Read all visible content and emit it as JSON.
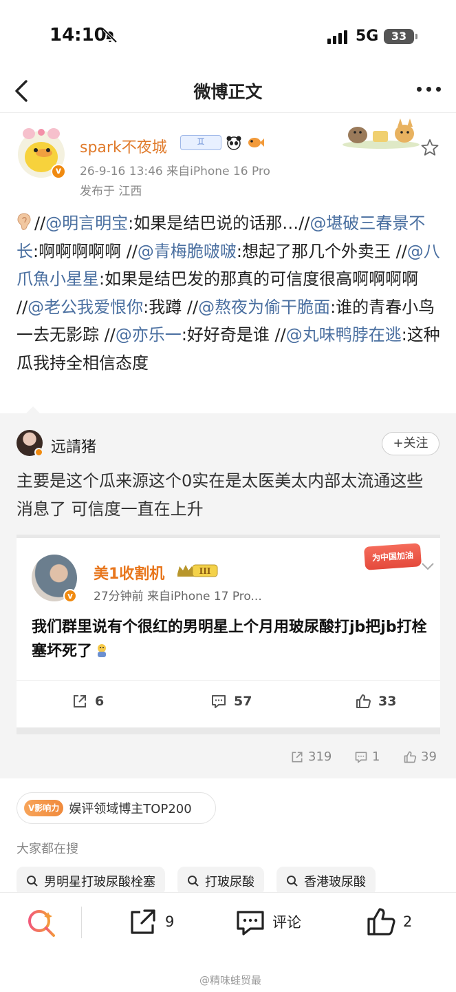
{
  "status_bar": {
    "time": "14:10",
    "network": "5G",
    "battery": "33"
  },
  "nav": {
    "title": "微博正文"
  },
  "post": {
    "username": "spark不夜城",
    "level_badge": "♊",
    "meta": "26-9-16 13:46  来自iPhone 16 Pro",
    "location": "发布于 江西",
    "segments": [
      {
        "t": "//",
        "m": false
      },
      {
        "t": "@明言明宝",
        "m": true
      },
      {
        "t": ":如果是结巴说的话那…//",
        "m": false
      },
      {
        "t": "@堪破三春景不长",
        "m": true
      },
      {
        "t": ":啊啊啊啊啊 //",
        "m": false
      },
      {
        "t": "@青梅脆啵啵",
        "m": true
      },
      {
        "t": ":想起了那几个外卖王 //",
        "m": false
      },
      {
        "t": "@八爪魚小星星",
        "m": true
      },
      {
        "t": ":如果是结巴发的那真的可信度很高啊啊啊啊 //",
        "m": false
      },
      {
        "t": "@老公我爱恨你",
        "m": true
      },
      {
        "t": ":我蹲 //",
        "m": false
      },
      {
        "t": "@熬夜为偷干脆面",
        "m": true
      },
      {
        "t": ":谁的青春小鸟一去无影踪 //",
        "m": false
      },
      {
        "t": "@亦乐一",
        "m": true
      },
      {
        "t": ":好好奇是谁 //",
        "m": false
      },
      {
        "t": "@丸味鸭脖在逃",
        "m": true
      },
      {
        "t": ":这种瓜我持全相信态度",
        "m": false
      }
    ]
  },
  "repost": {
    "username": "远請猪",
    "follow_label": "+关注",
    "text": "主要是这个瓜来源这个0实在是太医美太内部太流通这些消息了 可信度一直在上升",
    "card": {
      "username": "美1收割机",
      "rank": "III",
      "tag": "为中国加油",
      "meta": "27分钟前  来自iPhone 17 Pro...",
      "text": "我们群里说有个很红的男明星上个月用玻尿酸打jb把jb打栓塞坏死了",
      "shares": "6",
      "comments": "57",
      "likes": "33"
    },
    "shares": "319",
    "comments": "1",
    "likes": "39"
  },
  "influence": {
    "tag": "V影响力",
    "text": "娱评领域博主TOP200"
  },
  "search": {
    "label": "大家都在搜",
    "chips": [
      "男明星打玻尿酸栓塞",
      "打玻尿酸",
      "香港玻尿酸"
    ]
  },
  "bottom_bar": {
    "share_count": "9",
    "comment_label": "评论",
    "like_count": "2"
  },
  "watermark": "@精味蛙贸最"
}
